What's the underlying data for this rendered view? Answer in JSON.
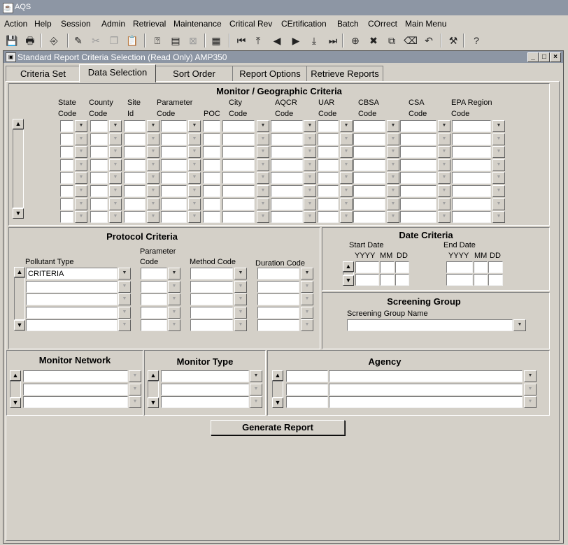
{
  "app": {
    "title": "AQS"
  },
  "menu": [
    "Action",
    "Help",
    "Session",
    "Admin",
    "Retrieval",
    "Maintenance",
    "Critical Rev",
    "CErtification",
    "Batch",
    "COrrect",
    "Main Menu"
  ],
  "toolbar": {
    "icons": [
      "save-icon",
      "print-icon",
      "exit-icon",
      "edit-icon",
      "cut-icon",
      "copy-icon",
      "paste-icon",
      "query-icon",
      "execute-query-icon",
      "cancel-query-icon",
      "calculator-icon",
      "first-record-icon",
      "top-icon",
      "previous-icon",
      "next-icon",
      "down-icon",
      "last-record-icon",
      "insert-record-icon",
      "delete-record-icon",
      "duplicate-icon",
      "clear-icon",
      "undo-icon",
      "tools-icon",
      "help-icon"
    ]
  },
  "window": {
    "title": "Standard Report Criteria Selection (Read Only) AMP350",
    "minimize": "_",
    "maximize": "□",
    "close": "×"
  },
  "tabs": [
    "Criteria Set",
    "Data Selection",
    "Sort Order",
    "Report Options",
    "Retrieve Reports"
  ],
  "active_tab": "Data Selection",
  "monitor": {
    "title": "Monitor / Geographic Criteria",
    "columns": [
      {
        "l1": "State",
        "l2": "Code"
      },
      {
        "l1": "County",
        "l2": "Code"
      },
      {
        "l1": "Site",
        "l2": "Id"
      },
      {
        "l1": "Parameter",
        "l2": "Code"
      },
      {
        "l1": "",
        "l2": "POC"
      },
      {
        "l1": "City",
        "l2": "Code"
      },
      {
        "l1": "AQCR",
        "l2": "Code"
      },
      {
        "l1": "UAR",
        "l2": "Code"
      },
      {
        "l1": "CBSA",
        "l2": "Code"
      },
      {
        "l1": "CSA",
        "l2": "Code"
      },
      {
        "l1": "EPA Region",
        "l2": "Code"
      }
    ],
    "rows": 8
  },
  "protocol": {
    "title": "Protocol Criteria",
    "pollutant_label": "Pollutant Type",
    "parameter_label1": "Parameter",
    "parameter_label2": "Code",
    "method_label": "Method Code",
    "duration_label": "Duration Code",
    "pollutant_values": [
      "CRITERIA",
      "",
      "",
      "",
      ""
    ]
  },
  "date": {
    "title": "Date Criteria",
    "start_label": "Start Date",
    "end_label": "End Date",
    "yyyy": "YYYY",
    "mm": "MM",
    "dd": "DD"
  },
  "screening": {
    "title": "Screening Group",
    "name_label": "Screening Group Name",
    "value": ""
  },
  "network": {
    "title": "Monitor Network"
  },
  "type": {
    "title": "Monitor Type"
  },
  "agency": {
    "title": "Agency"
  },
  "generate": {
    "label": "Generate Report"
  },
  "glyphs": {
    "dropdown": "▼",
    "up": "▲",
    "down": "▼"
  }
}
